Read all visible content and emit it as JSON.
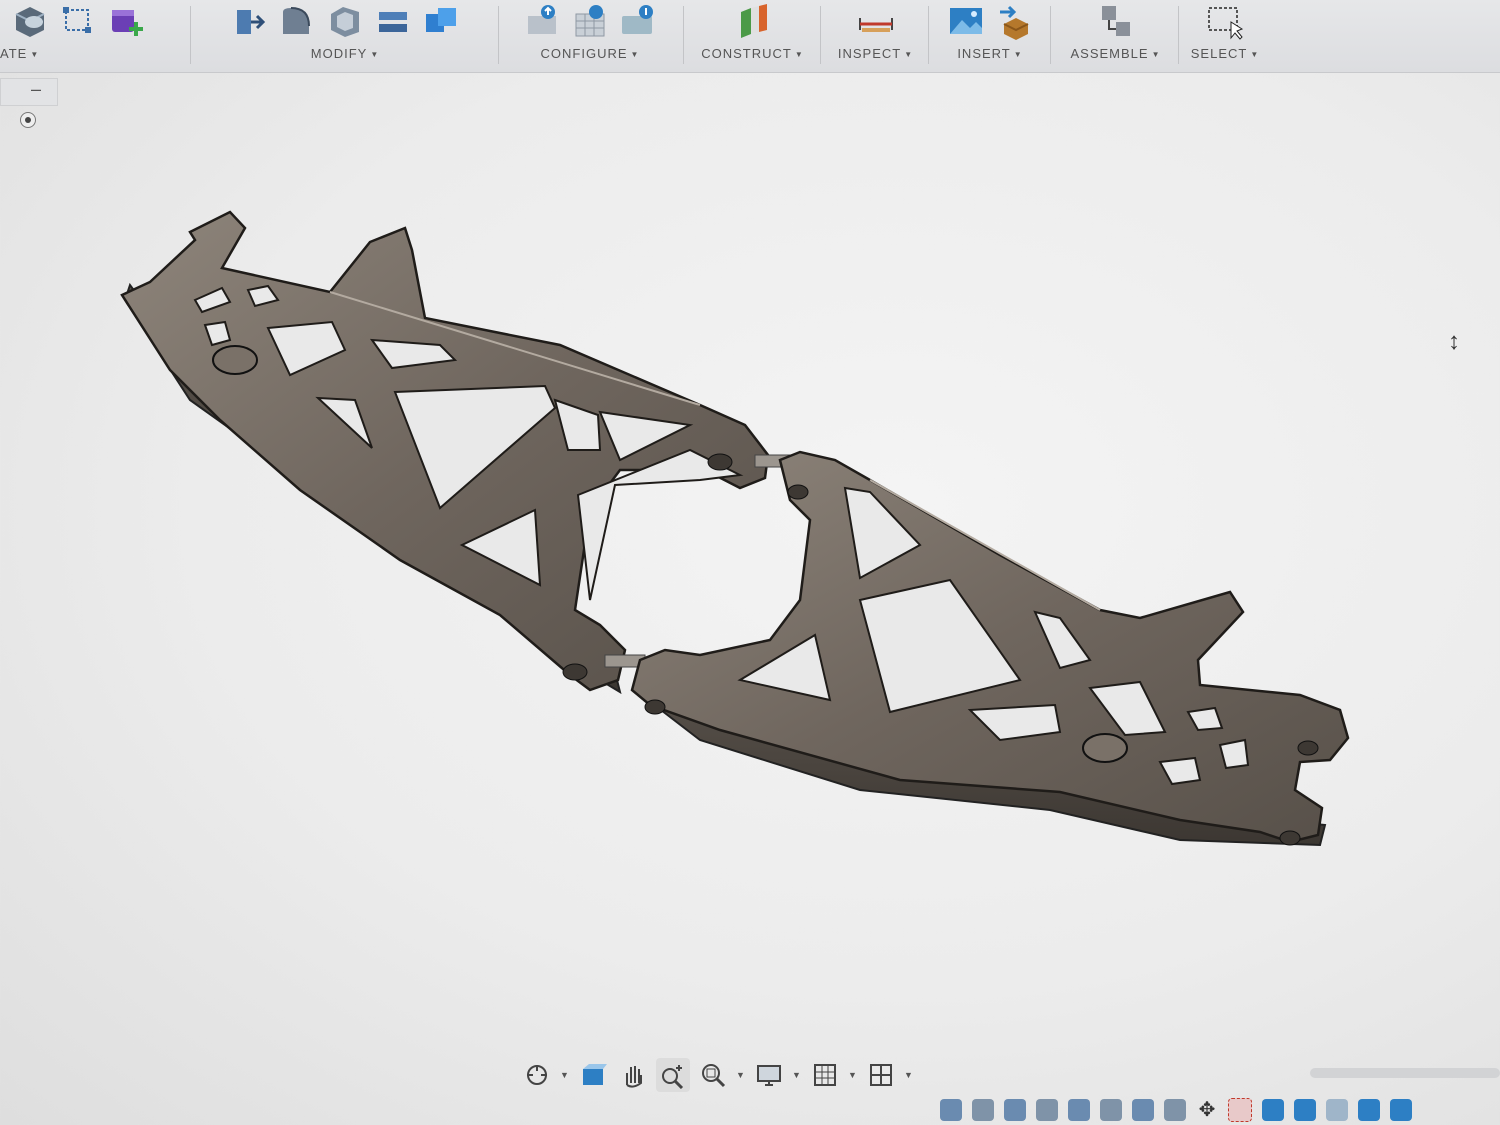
{
  "toolbar": {
    "groups": [
      {
        "id": "create",
        "label": "ATE",
        "icons": [
          "create-box-icon",
          "sketch-icon",
          "new-component-icon"
        ]
      },
      {
        "id": "modify",
        "label": "MODIFY",
        "icons": [
          "press-pull-icon",
          "fillet-icon",
          "shell-icon",
          "split-icon",
          "combine-icon"
        ]
      },
      {
        "id": "configure",
        "label": "CONFIGURE",
        "icons": [
          "configure-table-icon",
          "configure-grid-icon",
          "configure-theme-icon"
        ]
      },
      {
        "id": "construct",
        "label": "CONSTRUCT",
        "icons": [
          "construct-plane-icon"
        ]
      },
      {
        "id": "inspect",
        "label": "INSPECT",
        "icons": [
          "measure-icon"
        ]
      },
      {
        "id": "insert",
        "label": "INSERT",
        "icons": [
          "insert-image-icon",
          "insert-mesh-icon"
        ]
      },
      {
        "id": "assemble",
        "label": "ASSEMBLE",
        "icons": [
          "joint-icon"
        ]
      },
      {
        "id": "select",
        "label": "SELECT",
        "icons": [
          "window-select-icon"
        ]
      }
    ]
  },
  "left_panel": {
    "collapse_symbol": "–"
  },
  "nav_bar": {
    "tools": [
      "orbit-icon",
      "look-at-icon",
      "pan-icon",
      "zoom-icon",
      "fit-icon",
      "display-settings-icon",
      "grid-icon",
      "viewports-icon"
    ]
  },
  "colors": {
    "part": "#6f665e",
    "part_light": "#8e857b",
    "part_dark": "#4a443e",
    "accent_blue": "#2d7fc4"
  }
}
